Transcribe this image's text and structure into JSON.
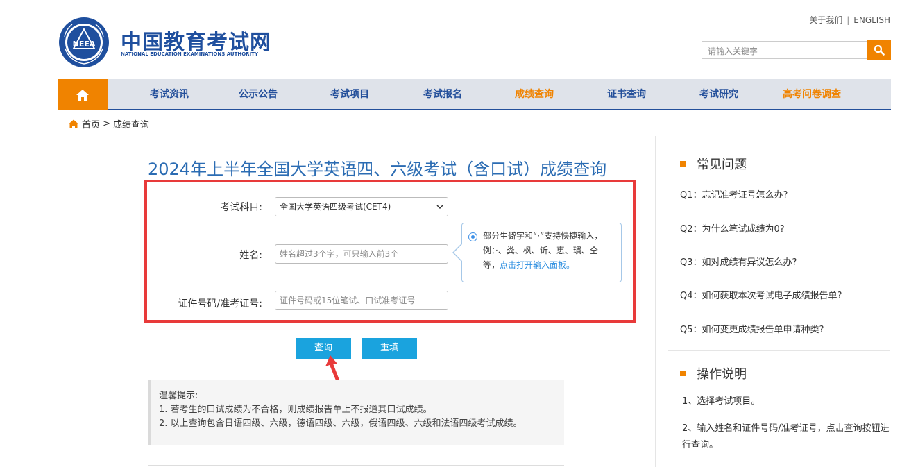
{
  "header": {
    "logo_cn": "中国教育考试网",
    "logo_en": "NATIONAL EDUCATION EXAMINATIONS AUTHORITY",
    "logo_emblem_text": "NEEA",
    "top_links": {
      "about": "关于我们",
      "separator": "|",
      "english": "ENGLISH"
    },
    "search": {
      "placeholder": "请输入关键字",
      "icon": "search-icon"
    }
  },
  "nav": {
    "home_icon": "home-icon",
    "items": [
      {
        "label": "考试资讯"
      },
      {
        "label": "公示公告"
      },
      {
        "label": "考试项目"
      },
      {
        "label": "考试报名"
      },
      {
        "label": "成绩查询",
        "active": true
      },
      {
        "label": "证书查询"
      },
      {
        "label": "考试研究"
      },
      {
        "label": "高考问卷调查",
        "highlight": true
      }
    ]
  },
  "breadcrumb": {
    "home": "首页",
    "separator": ">",
    "current": "成绩查询"
  },
  "main": {
    "title": "2024年上半年全国大学英语四、六级考试（含口试）成绩查询",
    "form": {
      "subject_label": "考试科目:",
      "subject_value": "全国大学英语四级考试(CET4)",
      "name_label": "姓名:",
      "name_placeholder": "姓名超过3个字，可只输入前3个",
      "id_label": "证件号码/准考证号:",
      "id_placeholder": "证件号码或15位笔试、口试准考证号"
    },
    "tooltip": {
      "text": "部分生僻字和“·”支持快捷输入，例：·、粪、枫、䜣、恵、瑻、仝等，",
      "link": "点击打开输入面板。"
    },
    "buttons": {
      "query": "查询",
      "reset": "重填"
    },
    "notice": {
      "title": "温馨提示:",
      "lines": [
        "1. 若考生的口试成绩为不合格，则成绩报告单上不报道其口试成绩。",
        "2. 以上查询包含日语四级、六级，德语四级、六级，俄语四级、六级和法语四级考试成绩。"
      ]
    }
  },
  "sidebar": {
    "faq_title": "常见问题",
    "faq": [
      "Q1：忘记准考证号怎么办?",
      "Q2：为什么笔试成绩为0?",
      "Q3：如对成绩有异议怎么办?",
      "Q4：如何获取本次考试电子成绩报告单?",
      "Q5：如何变更成绩报告单申请种类?"
    ],
    "ops_title": "操作说明",
    "ops": [
      "1、选择考试项目。",
      "2、输入姓名和证件号码/准考证号，点击查询按钮进行查询。"
    ]
  },
  "colors": {
    "brand_blue": "#234f9a",
    "accent_orange": "#f08300",
    "button_blue": "#1aa3de",
    "highlight_red": "#e83a3a"
  }
}
